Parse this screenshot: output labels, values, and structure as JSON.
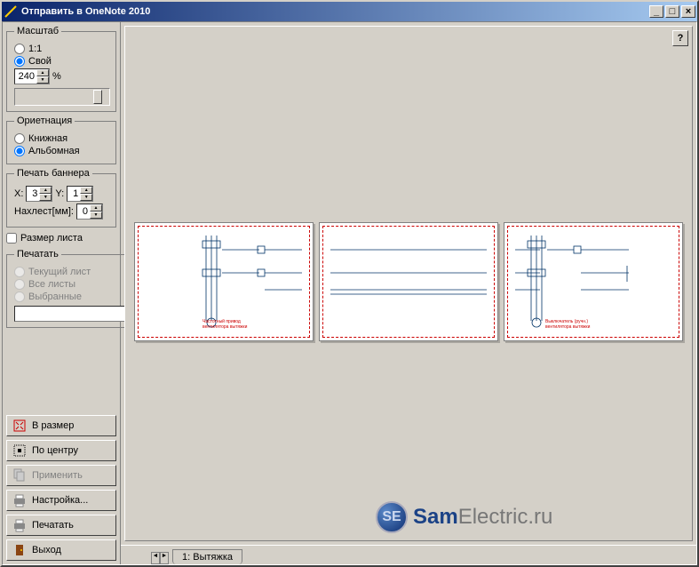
{
  "window": {
    "title": "Отправить в OneNote 2010"
  },
  "scale": {
    "legend": "Масштаб",
    "opt_1_1": "1:1",
    "opt_custom": "Свой",
    "value": "240",
    "percent": "%"
  },
  "orient": {
    "legend": "Ориетнация",
    "opt_portrait": "Книжная",
    "opt_landscape": "Альбомная"
  },
  "banner": {
    "legend": "Печать баннера",
    "x_label": "X:",
    "x_value": "3",
    "y_label": "Y:",
    "y_value": "1",
    "overlap_label": "Нахлест[мм]:",
    "overlap_value": "0"
  },
  "sheet_size": {
    "label": "Размер листа"
  },
  "print": {
    "legend": "Печатать",
    "opt_current": "Текущий лист",
    "opt_all": "Все листы",
    "opt_selected": "Выбранные",
    "browse": "..."
  },
  "buttons": {
    "fit": "В размер",
    "center": "По центру",
    "apply": "Применить",
    "setup": "Настройка...",
    "print": "Печатать",
    "exit": "Выход"
  },
  "tab": {
    "label": "1: Вытяжка"
  },
  "help": {
    "label": "?"
  },
  "watermark": {
    "badge": "SE",
    "t1": "Sam",
    "t2": "Electric.ru"
  },
  "titlebar": {
    "min": "_",
    "max": "□",
    "close": "×"
  }
}
